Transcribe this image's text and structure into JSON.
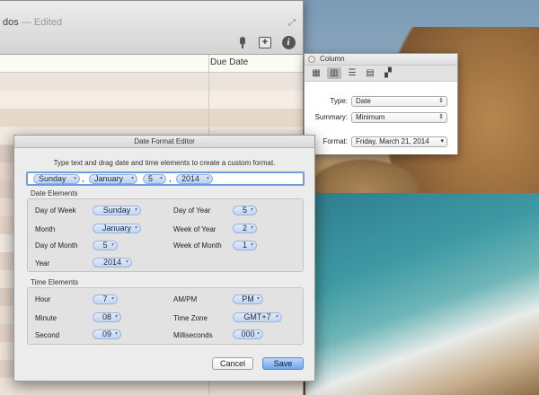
{
  "document": {
    "title": "dos",
    "edited": "— Edited",
    "column_header": "Due Date",
    "row_colors": [
      "#ece4dc",
      "#f5ede4",
      "#e8d8c9",
      "#f3ebe2",
      "#dbcfc6",
      "#ebdad0",
      "#e2d3c6",
      "#efe1d8",
      "#e9d6cb",
      "#f4ede7",
      "#e6d6cc",
      "#f1e6dc",
      "#dfd1c6",
      "#ece1d6",
      "#e5d4c7",
      "#f0e5dc",
      "#e3d5c9",
      "#eee3d9"
    ]
  },
  "toolbar": {
    "icons": [
      "microphone-icon",
      "add-icon",
      "info-icon"
    ],
    "plus": "+",
    "info": "i"
  },
  "inspector": {
    "title": "Column",
    "type_label": "Type:",
    "type_value": "Date",
    "summary_label": "Summary:",
    "summary_value": "Minimum",
    "format_label": "Format:",
    "format_value": "Friday, March 21, 2014"
  },
  "editor": {
    "title": "Date Format Editor",
    "instructions": "Type text and drag date and time elements to create a custom format.",
    "format_tokens": [
      "Sunday",
      ",",
      "January",
      "5",
      ",",
      "2014"
    ],
    "date_group_label": "Date Elements",
    "date_elements": [
      {
        "label": "Day of Week",
        "value": "Sunday"
      },
      {
        "label": "Month",
        "value": "January"
      },
      {
        "label": "Day of Month",
        "value": "5"
      },
      {
        "label": "Year",
        "value": "2014"
      },
      {
        "label": "Day of Year",
        "value": "5"
      },
      {
        "label": "Week of Year",
        "value": "2"
      },
      {
        "label": "Week of Month",
        "value": "1"
      }
    ],
    "time_group_label": "Time Elements",
    "time_elements": [
      {
        "label": "Hour",
        "value": "7"
      },
      {
        "label": "Minute",
        "value": "08"
      },
      {
        "label": "Second",
        "value": "09"
      },
      {
        "label": "AM/PM",
        "value": "PM"
      },
      {
        "label": "Time Zone",
        "value": "GMT+7"
      },
      {
        "label": "Milliseconds",
        "value": "000"
      }
    ],
    "cancel_label": "Cancel",
    "save_label": "Save"
  },
  "colors": {
    "accent": "#6ea6ef",
    "token_fill": "#c2d4f0"
  }
}
